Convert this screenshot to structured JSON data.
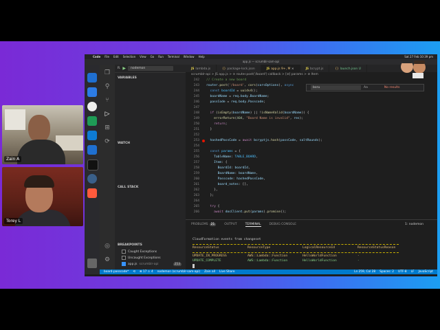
{
  "participants": [
    {
      "name": "Zain A"
    },
    {
      "name": "Torey L"
    }
  ],
  "menubar": {
    "app": "Code",
    "items": [
      "File",
      "Edit",
      "Selection",
      "View",
      "Go",
      "Run",
      "Terminal",
      "Window",
      "Help"
    ],
    "clock": "Sat 27 Feb 10:39 pm"
  },
  "window": {
    "title": "app.js — scrumblr-sam-api"
  },
  "sidebar": {
    "run_config": "nodemon",
    "variables": "VARIABLES",
    "watch": "WATCH",
    "call_stack": "CALL STACK",
    "breakpoints": "BREAKPOINTS",
    "bp_items": [
      {
        "label": "Caught Exceptions",
        "checked": false
      },
      {
        "label": "Uncaught Exceptions",
        "checked": false
      },
      {
        "label": "app.js",
        "detail": "scrumblr-api",
        "line": "253",
        "checked": true
      }
    ]
  },
  "tabs": [
    {
      "label": "lambda.js",
      "type": "JS"
    },
    {
      "label": "package-lock.json",
      "type": "{}"
    },
    {
      "label": "app.js 9+, M",
      "type": "JS",
      "active": true
    },
    {
      "label": "bcrypt.js",
      "type": "JS"
    },
    {
      "label": "launch.json U",
      "type": "{}"
    }
  ],
  "breadcrumb": "scrumblr-api > JS app.js > ⊙ router.post('/board') callback > [⊘] params > ⊘ Item",
  "find": {
    "value": "boru",
    "result": "No results"
  },
  "editor": {
    "line_numbers": [
      "242",
      "243",
      "244",
      "245",
      "246",
      "247",
      "248",
      "249",
      "250",
      "251",
      "252",
      "253",
      "254",
      "255",
      "256",
      "257",
      "258",
      "259",
      "260",
      "261",
      "262",
      "263",
      "264",
      "265",
      "266"
    ]
  },
  "panel": {
    "tabs": [
      "PROBLEMS",
      "OUTPUT",
      "TERMINAL",
      "DEBUG CONSOLE"
    ],
    "problems_count": "21",
    "active_tab": "TERMINAL",
    "terminal_select": "1: nodemon",
    "heading": "CloudFormation events from changeset",
    "headers": [
      "ResourceStatus",
      "ResourceType",
      "LogicalResourceId",
      "ResourceStatusReason"
    ],
    "rows": [
      [
        "UPDATE_IN_PROGRESS",
        "AWS::Lambda::Function",
        "HelloWorldFunction",
        "-"
      ],
      [
        "UPDATE_COMPLETE",
        "AWS::Lambda::Function",
        "HelloWorldFunction",
        "-"
      ]
    ]
  },
  "status": {
    "branch": "board-passcode*",
    "sync": "⟲",
    "errors": "⊗ 17 ⚠ 4",
    "debug": "nodemon (scrumblr-sam-api)",
    "user": "Zain all",
    "share": "Live Share",
    "position": "Ln 259, Col 28",
    "spaces": "Spaces: 2",
    "encoding": "UTF-8",
    "eol": "LF",
    "language": "JavaScript"
  }
}
